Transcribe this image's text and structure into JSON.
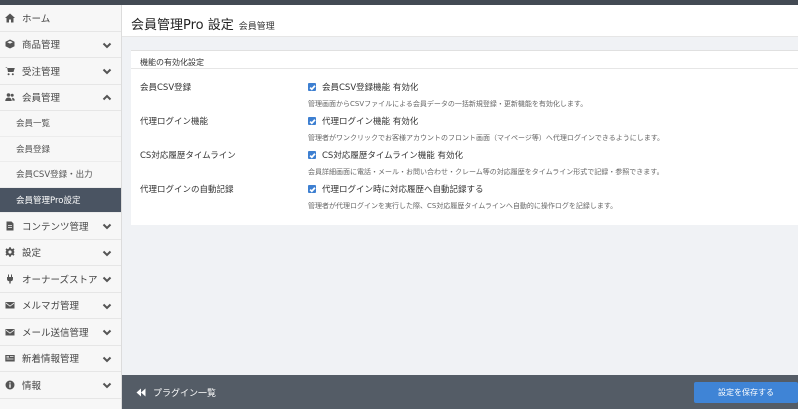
{
  "sidebar": {
    "items": [
      {
        "label": "ホーム",
        "icon": "home-icon"
      },
      {
        "label": "商品管理",
        "icon": "cube-icon"
      },
      {
        "label": "受注管理",
        "icon": "cart-icon"
      },
      {
        "label": "会員管理",
        "icon": "users-icon"
      },
      {
        "label": "コンテンツ管理",
        "icon": "document-icon"
      },
      {
        "label": "設定",
        "icon": "gear-icon"
      },
      {
        "label": "オーナーズストア",
        "icon": "plug-icon"
      },
      {
        "label": "メルマガ管理",
        "icon": "envelope-icon"
      },
      {
        "label": "メール送信管理",
        "icon": "envelope-icon"
      },
      {
        "label": "新着情報管理",
        "icon": "newspaper-icon"
      },
      {
        "label": "情報",
        "icon": "info-icon"
      }
    ],
    "sub_items": [
      {
        "label": "会員一覧"
      },
      {
        "label": "会員登録"
      },
      {
        "label": "会員CSV登録・出力"
      },
      {
        "label": "会員管理Pro設定",
        "active": true
      }
    ]
  },
  "header": {
    "title": "会員管理Pro 設定",
    "subtitle": "会員管理"
  },
  "card": {
    "heading": "機能の有効化設定",
    "rows": [
      {
        "label": "会員CSV登録",
        "checkbox_label": "会員CSV登録機能 有効化",
        "checked": true,
        "help": "管理画面からCSVファイルによる会員データの一括新規登録・更新機能を有効化します。"
      },
      {
        "label": "代理ログイン機能",
        "checkbox_label": "代理ログイン機能 有効化",
        "checked": true,
        "help": "管理者がワンクリックでお客様アカウントのフロント画面（マイページ等）へ代理ログインできるようにします。"
      },
      {
        "label": "CS対応履歴タイムライン",
        "checkbox_label": "CS対応履歴タイムライン機能 有効化",
        "checked": true,
        "help": "会員詳細画面に電話・メール・お問い合わせ・クレーム等の対応履歴をタイムライン形式で記録・参照できます。"
      },
      {
        "label": "代理ログインの自動記録",
        "checkbox_label": "代理ログイン時に対応履歴へ自動記録する",
        "checked": true,
        "help": "管理者が代理ログインを実行した際、CS対応履歴タイムラインへ自動的に操作ログを記録します。"
      }
    ]
  },
  "footer": {
    "back_label": "プラグイン一覧",
    "save_label": "設定を保存する"
  },
  "colors": {
    "accent": "#3f84d6",
    "sidebar_active": "#4a5462",
    "footer": "#545c66",
    "topbar": "#434a54"
  }
}
